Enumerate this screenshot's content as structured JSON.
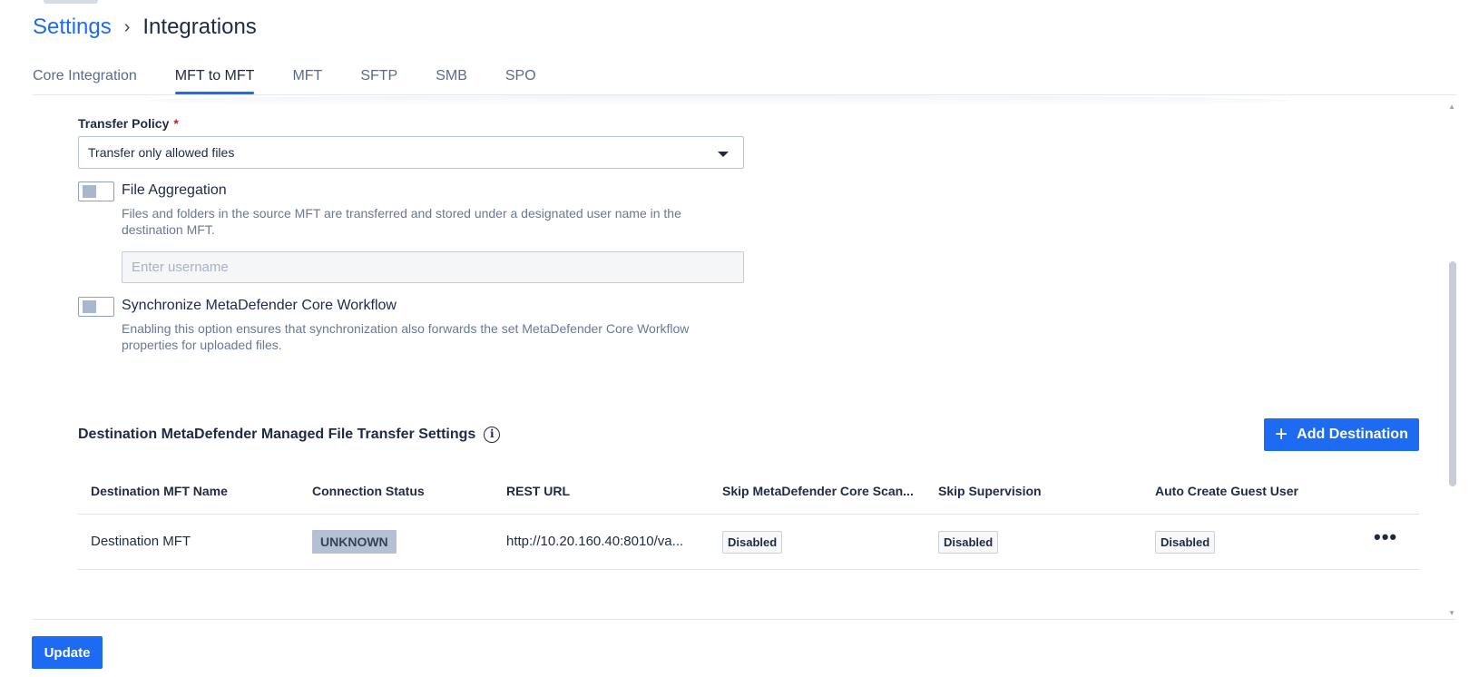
{
  "breadcrumb": {
    "root": "Settings",
    "separator": "›",
    "current": "Integrations"
  },
  "tabs": [
    {
      "label": "Core Integration",
      "active": false
    },
    {
      "label": "MFT to MFT",
      "active": true
    },
    {
      "label": "MFT",
      "active": false
    },
    {
      "label": "SFTP",
      "active": false
    },
    {
      "label": "SMB",
      "active": false
    },
    {
      "label": "SPO",
      "active": false
    }
  ],
  "transfer_policy": {
    "label": "Transfer Policy",
    "required_mark": "*",
    "selected": "Transfer only allowed files"
  },
  "file_aggregation": {
    "title": "File Aggregation",
    "enabled": false,
    "description": "Files and folders in the source MFT are transferred and stored under a designated user name in the destination MFT.",
    "username_placeholder": "Enter username",
    "username_value": ""
  },
  "sync_workflow": {
    "title": "Synchronize MetaDefender Core Workflow",
    "enabled": false,
    "description": "Enabling this option ensures that synchronization also forwards the set MetaDefender Core Workflow properties for uploaded files."
  },
  "destinations": {
    "title": "Destination MetaDefender Managed File Transfer Settings",
    "info_icon": "info-icon",
    "add_button": {
      "icon": "plus-icon",
      "label": "Add Destination"
    },
    "columns": [
      "Destination MFT Name",
      "Connection Status",
      "REST URL",
      "Skip MetaDefender Core Scan...",
      "Skip Supervision",
      "Auto Create Guest User"
    ],
    "rows": [
      {
        "name": "Destination MFT",
        "status": "UNKNOWN",
        "rest_url": "http://10.20.160.40:8010/va...",
        "skip_core_scan": "Disabled",
        "skip_supervision": "Disabled",
        "auto_create_guest": "Disabled",
        "more_icon": "•••"
      }
    ]
  },
  "footer": {
    "update_label": "Update"
  },
  "colors": {
    "accent": "#1d6bf3",
    "required": "#d01919",
    "status_unknown_bg": "#b6c0d4"
  }
}
